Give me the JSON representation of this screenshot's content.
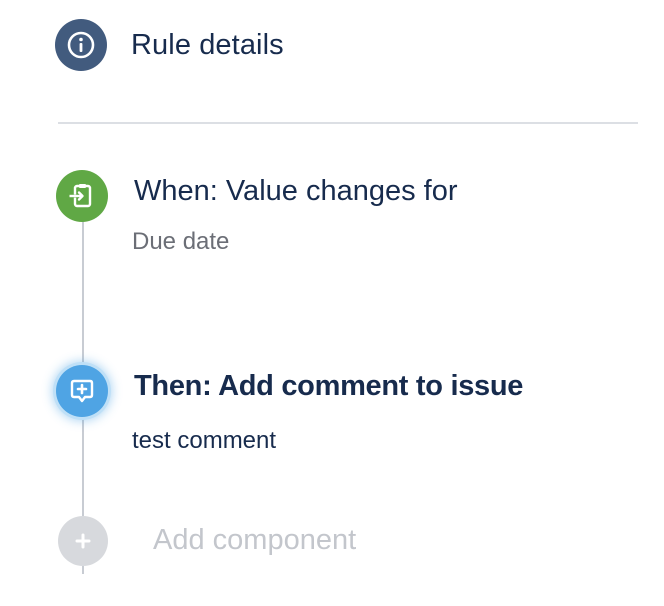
{
  "header": {
    "title": "Rule details",
    "icon": "info-icon",
    "icon_color": "#425b7e"
  },
  "steps": [
    {
      "kind": "trigger",
      "title": "When: Value changes for",
      "subtitle": "Due date",
      "icon": "trigger-clipboard-icon",
      "color": "#60a845"
    },
    {
      "kind": "action",
      "title": "Then: Add comment to issue",
      "subtitle": "test comment",
      "icon": "add-comment-icon",
      "color": "#4fa4e4",
      "selected": true
    }
  ],
  "add_component": {
    "label": "Add component",
    "icon": "plus-icon",
    "color": "#d7d9dd"
  }
}
